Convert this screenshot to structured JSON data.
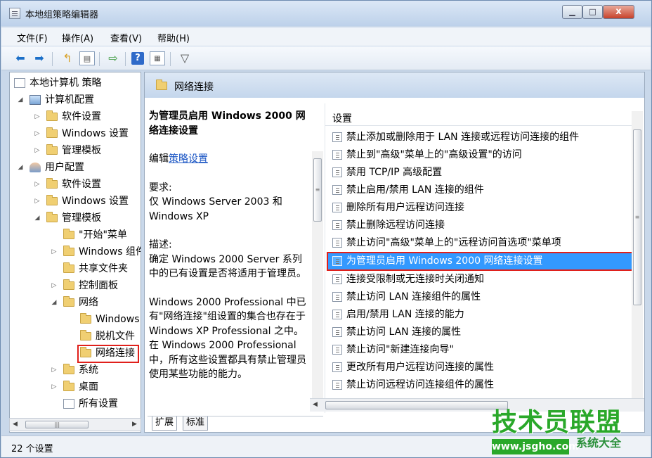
{
  "window": {
    "title": "本地组策略编辑器",
    "min": "▁",
    "max": "□",
    "close": "x"
  },
  "menu": [
    "文件(F)",
    "操作(A)",
    "查看(V)",
    "帮助(H)"
  ],
  "tree": {
    "root": "本地计算机 策略",
    "computer_config": "计算机配置",
    "cc_software": "软件设置",
    "cc_windows": "Windows 设置",
    "cc_admin": "管理模板",
    "user_config": "用户配置",
    "uc_software": "软件设置",
    "uc_windows": "Windows 设置",
    "uc_admin": "管理模板",
    "start_menu": "\"开始\"菜单",
    "win_components": "Windows 组件",
    "shared_folders": "共享文件夹",
    "control_panel": "控制面板",
    "network": "网络",
    "windows_connect": "Windows",
    "offline_files": "脱机文件",
    "network_connections": "网络连接",
    "system": "系统",
    "desktop": "桌面",
    "all_settings": "所有设置"
  },
  "header": {
    "title": "网络连接"
  },
  "description": {
    "title": "为管理员启用 Windows 2000 网络连接设置",
    "edit_prefix": "编辑",
    "edit_link": "策略设置",
    "requirements_label": "要求:",
    "requirements": "仅 Windows Server 2003 和 Windows XP",
    "desc_label": "描述:",
    "desc_text": "确定 Windows 2000 Server 系列中的已有设置是否将适用于管理员。",
    "more_text": "Windows 2000 Professional 中已有\"网络连接\"组设置的集合也存在于 Windows XP Professional 之中。在 Windows 2000 Professional 中，所有这些设置都具有禁止管理员使用某些功能的能力。"
  },
  "tabs": [
    "扩展",
    "标准"
  ],
  "list": {
    "header": "设置",
    "rows": [
      "禁止添加或删除用于 LAN 连接或远程访问连接的组件",
      "禁止到\"高级\"菜单上的\"高级设置\"的访问",
      "禁用 TCP/IP 高级配置",
      "禁止启用/禁用 LAN 连接的组件",
      "删除所有用户远程访问连接",
      "禁止删除远程访问连接",
      "禁止访问\"高级\"菜单上的\"远程访问首选项\"菜单项",
      "为管理员启用 Windows 2000 网络连接设置",
      "连接受限制或无连接时关闭通知",
      "禁止访问 LAN 连接组件的属性",
      "启用/禁用 LAN 连接的能力",
      "禁止访问 LAN 连接的属性",
      "禁止访问\"新建连接向导\"",
      "更改所有用户远程访问连接的属性",
      "禁止访问远程访问连接组件的属性"
    ],
    "selected_index": 7
  },
  "status": {
    "text": "22 个设置"
  },
  "watermark": {
    "main": "技术员联盟",
    "url": "www.jsgho.com",
    "side": "系统大全"
  },
  "colors": {
    "selection": "#3399ff",
    "highlight_box": "#e0201b",
    "link": "#1a55c4",
    "watermark": "#2aa82a"
  }
}
